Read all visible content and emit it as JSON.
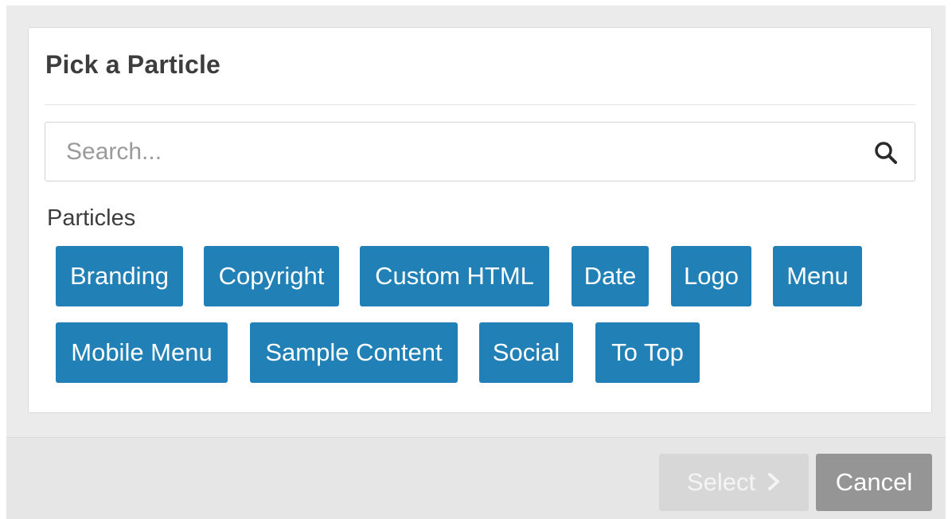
{
  "dialog": {
    "title": "Pick a Particle"
  },
  "search": {
    "placeholder": "Search...",
    "value": "",
    "icon": "search-icon"
  },
  "particles": {
    "section_label": "Particles",
    "items": [
      {
        "label": "Branding"
      },
      {
        "label": "Copyright"
      },
      {
        "label": "Custom HTML"
      },
      {
        "label": "Date"
      },
      {
        "label": "Logo"
      },
      {
        "label": "Menu"
      },
      {
        "label": "Mobile Menu"
      },
      {
        "label": "Sample Content"
      },
      {
        "label": "Social"
      },
      {
        "label": "To Top"
      }
    ]
  },
  "footer": {
    "select_label": "Select",
    "select_icon": "chevron-right-icon",
    "select_disabled": true,
    "cancel_label": "Cancel"
  },
  "colors": {
    "chip_background": "#2181b6",
    "select_disabled_background": "#d7d7d7",
    "cancel_background": "#959595",
    "modal_background": "#ebebeb"
  }
}
